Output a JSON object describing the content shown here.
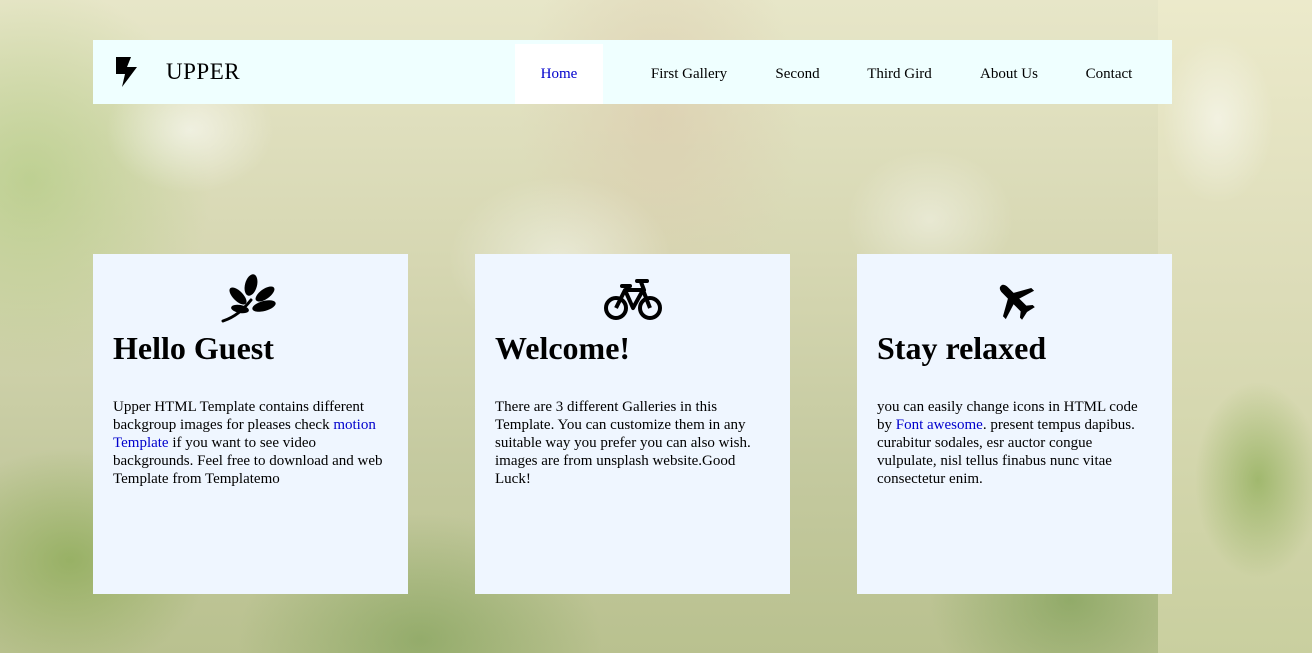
{
  "brand": {
    "name": "UPPER",
    "icon": "bolt-icon"
  },
  "nav": {
    "items": [
      {
        "label": "Home",
        "active": true
      },
      {
        "label": "First Gallery",
        "active": false
      },
      {
        "label": "Second",
        "active": false
      },
      {
        "label": "Third Gird",
        "active": false
      },
      {
        "label": "About Us",
        "active": false
      },
      {
        "label": "Contact",
        "active": false
      }
    ]
  },
  "cards": [
    {
      "icon": "leaf-icon",
      "title": "Hello Guest",
      "text_before": "Upper HTML Template contains different backgroup images for pleases check ",
      "link": "motion Template",
      "text_after": " if you want to see video backgrounds. Feel free to download and web Template from Templatemo"
    },
    {
      "icon": "bicycle-icon",
      "title": "Welcome!",
      "text": "There are 3 different Galleries in this Template. You can customize them in any suitable way you prefer you can also wish. images are from unsplash website.Good Luck!"
    },
    {
      "icon": "plane-icon",
      "title": "Stay relaxed",
      "text_before": "you can easily change icons in HTML code by ",
      "link": "Font awesome",
      "text_after": ". present tempus dapibus. curabitur sodales, esr auctor congue vulpulate, nisl tellus finabus nunc vitae consectetur enim."
    }
  ],
  "colors": {
    "navbar_bg": "#efffff",
    "card_bg": "#eff6ff",
    "link": "#0000cc"
  }
}
